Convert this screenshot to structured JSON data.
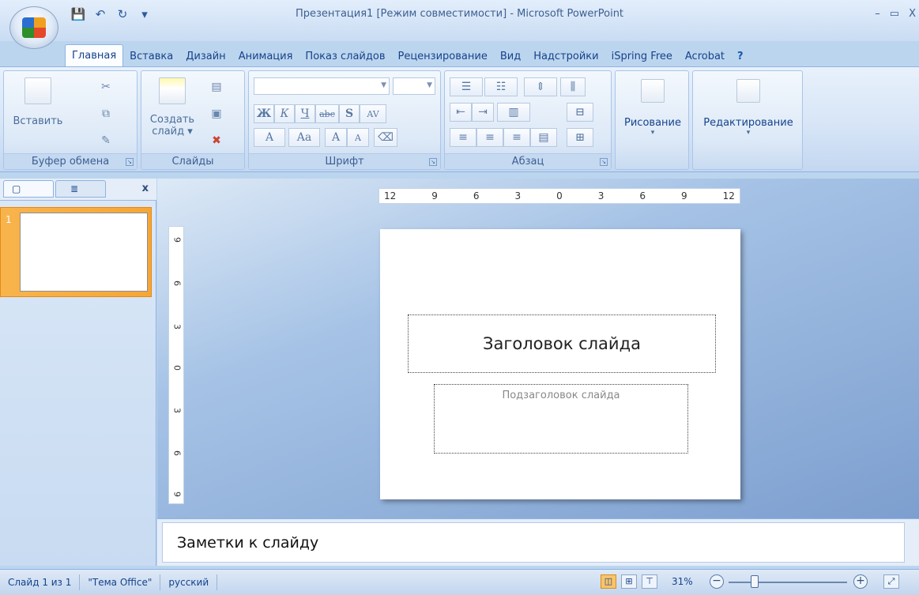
{
  "window": {
    "title": "Презентация1 [Режим совместимости] - Microsoft PowerPoint",
    "controls": [
      "–",
      "▭",
      "X"
    ]
  },
  "quick_access": [
    "💾",
    "↶",
    "↻",
    "▾"
  ],
  "ribbon_tabs": [
    {
      "label": "Главная",
      "active": true
    },
    {
      "label": "Вставка"
    },
    {
      "label": "Дизайн"
    },
    {
      "label": "Анимация"
    },
    {
      "label": "Показ слайдов"
    },
    {
      "label": "Рецензирование"
    },
    {
      "label": "Вид"
    },
    {
      "label": "Надстройки"
    },
    {
      "label": "iSpring Free"
    },
    {
      "label": "Acrobat"
    }
  ],
  "help_icon": "?",
  "groups": {
    "clipboard": {
      "label": "Буфер обмена",
      "paste": "Вставить"
    },
    "slides": {
      "label": "Слайды",
      "new_slide_1": "Создать",
      "new_slide_2": "слайд ▾"
    },
    "font": {
      "label": "Шрифт",
      "bold": "Ж",
      "italic": "К",
      "underline": "Ч",
      "strike": "abc",
      "shadow": "S",
      "spacing": "AV",
      "color": "A",
      "case": "Aa",
      "grow": "A",
      "shrink": "A"
    },
    "paragraph": {
      "label": "Абзац"
    },
    "drawing": {
      "label": "Рисование"
    },
    "editing": {
      "label": "Редактирование"
    }
  },
  "slide_panel": {
    "close": "x",
    "slide_number": "1"
  },
  "ruler": {
    "horizontal": [
      "12",
      "9",
      "6",
      "3",
      "0",
      "3",
      "6",
      "9",
      "12"
    ],
    "vertical": [
      "9",
      "6",
      "3",
      "0",
      "3",
      "6",
      "9"
    ]
  },
  "slide": {
    "title_placeholder": "Заголовок слайда",
    "subtitle_placeholder": "Подзаголовок слайда"
  },
  "notes": {
    "placeholder": "Заметки к слайду"
  },
  "status": {
    "slide_count": "Слайд 1 из 1",
    "theme": "\"Тема Office\"",
    "language": "русский",
    "zoom": "31%",
    "zoom_level_percent": 31
  }
}
